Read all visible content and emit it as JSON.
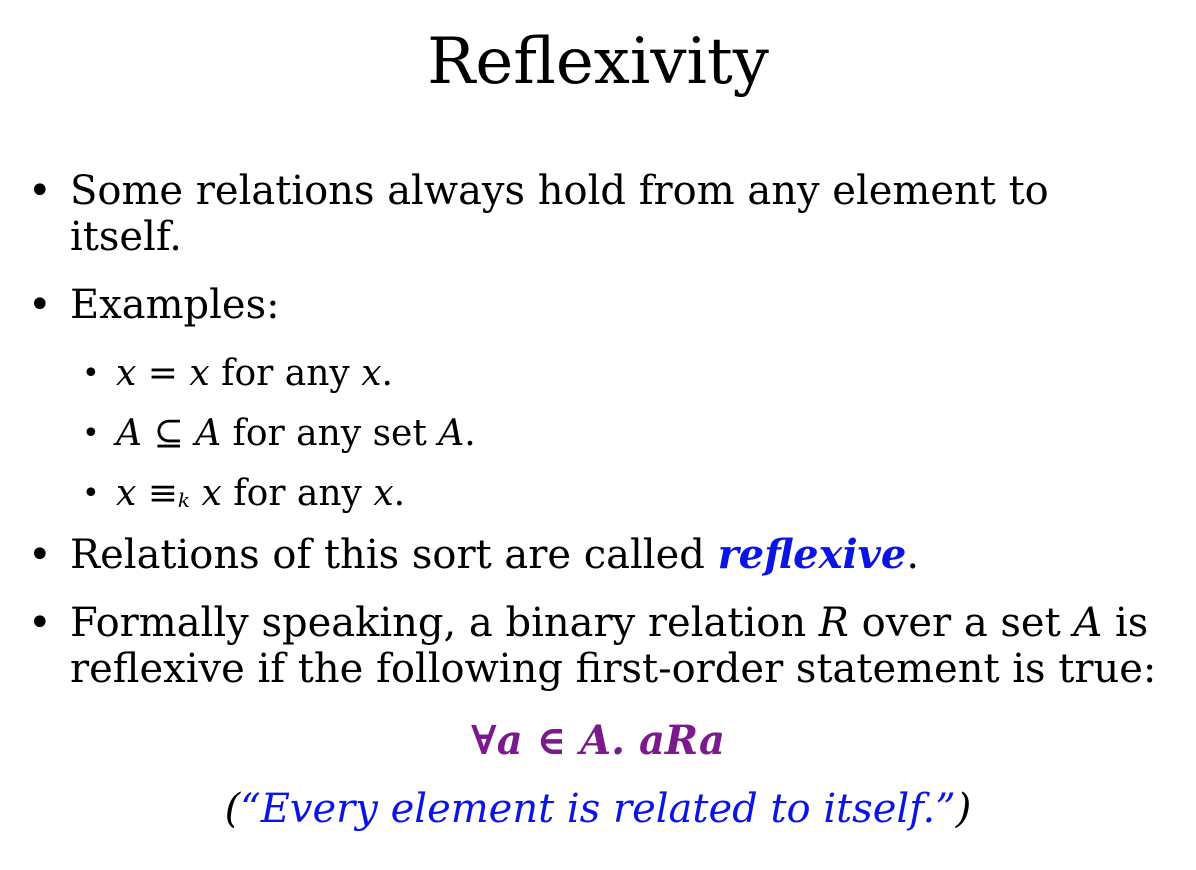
{
  "title": "Reflexivity",
  "bullets": {
    "b1": "Some relations always hold from any element to itself.",
    "b1_line1": "Some relations always hold from any element to",
    "b1_line2": "itself.",
    "b2": "Examples:",
    "b3_prefix": "Relations of this sort are called ",
    "b3_keyword": "reflexive",
    "b3_suffix": ".",
    "b4_line1_a": "Formally speaking, a binary relation ",
    "b4_line1_R": "R",
    "b4_line1_b": " over a set ",
    "b4_line1_A": "A",
    "b4_line1_c": " is",
    "b4_line2": "reflexive if the following first-order statement is true:"
  },
  "examples": {
    "e1_x1": "x",
    "e1_op": " = ",
    "e1_x2": "x",
    "e1_text": " for any ",
    "e1_x3": "x",
    "e1_end": ".",
    "e2_A1": "A",
    "e2_op": " ⊆ ",
    "e2_A2": "A",
    "e2_text": " for any set ",
    "e2_A3": "A",
    "e2_end": ".",
    "e3_x1": "x",
    "e3_op": " ≡",
    "e3_k": "k",
    "e3_x2": " x",
    "e3_text": " for any ",
    "e3_x3": "x",
    "e3_end": "."
  },
  "formula": "∀a ∈ A. aRa",
  "caption": {
    "open": "(",
    "quote": "“Every element is related to itself.”",
    "close": ")"
  },
  "bullet_symbol": "•",
  "colors": {
    "keyword": "#0a14e6",
    "formula": "#7a1a8c",
    "caption": "#0a14e6"
  }
}
